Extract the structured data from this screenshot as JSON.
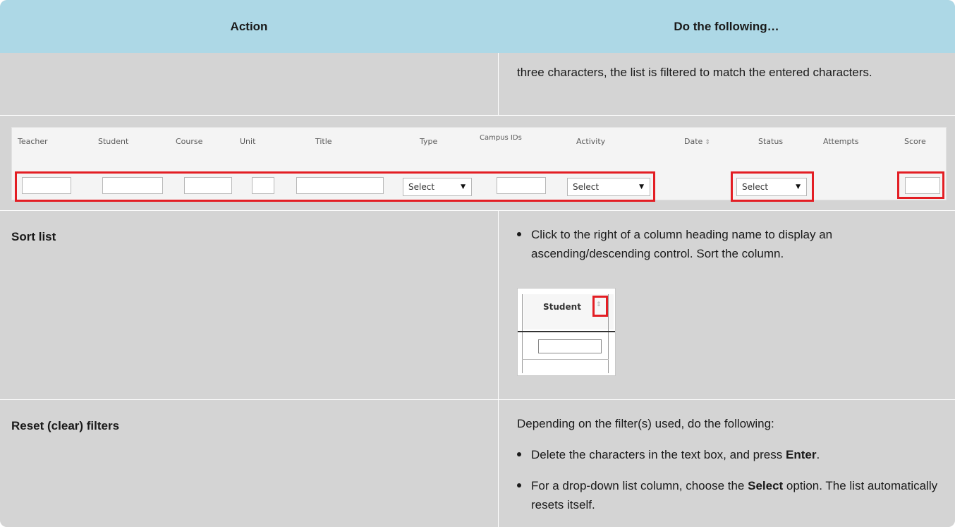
{
  "header": {
    "action": "Action",
    "todo": "Do the following…"
  },
  "row_filter_text": {
    "continuation": "three characters, the list is filtered to match the entered characters."
  },
  "filter_strip": {
    "columns": [
      "Teacher",
      "Student",
      "Course",
      "Unit",
      "Title",
      "Type",
      "Campus IDs",
      "Activity",
      "Date",
      "Status",
      "Attempts",
      "Score"
    ],
    "select_label": "Select",
    "sort_arrow": "⇕",
    "dropdown_arrow": "▼"
  },
  "row_sort": {
    "action": "Sort list",
    "bullet": "Click to the right of a column heading name to display an ascending/descending control. Sort the column.",
    "mini_title": "Student",
    "mini_sort_icon": "⇕"
  },
  "row_reset": {
    "action": "Reset (clear) filters",
    "intro": "Depending on the filter(s) used, do the following:",
    "b1_pre": "Delete the characters in the text box, and press ",
    "b1_bold": "Enter",
    "b1_post": ".",
    "b2_pre": "For a drop-down list column, choose the ",
    "b2_bold": "Select",
    "b2_post": " option. The list automatically resets itself."
  },
  "colors": {
    "header_bg": "#add8e6",
    "row_bg": "#d4d4d4",
    "highlight": "#e31e24"
  }
}
